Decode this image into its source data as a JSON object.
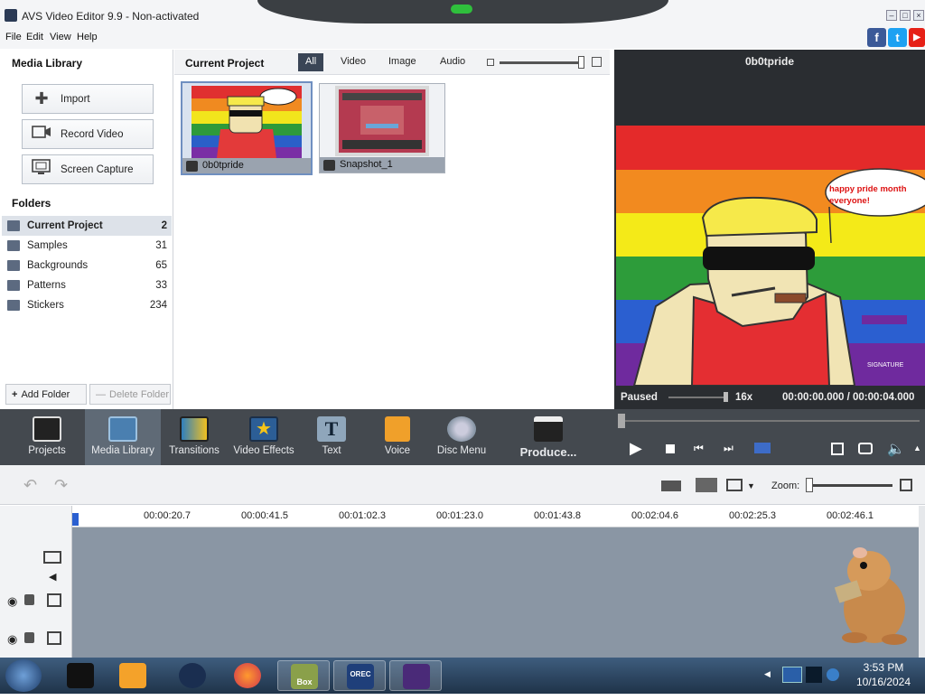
{
  "window": {
    "title": "AVS Video Editor 9.9 - Non-activated"
  },
  "menu": [
    "File",
    "Edit",
    "View",
    "Help"
  ],
  "social": {
    "facebook": "f",
    "twitter": "t",
    "youtube": "▶"
  },
  "media_library": {
    "header": "Media Library",
    "buttons": [
      {
        "label": "Import",
        "icon": "plus-icon"
      },
      {
        "label": "Record Video",
        "icon": "camera-icon"
      },
      {
        "label": "Screen Capture",
        "icon": "monitor-icon"
      }
    ],
    "folders_header": "Folders",
    "folders": [
      {
        "name": "Current Project",
        "count": "2"
      },
      {
        "name": "Samples",
        "count": "31"
      },
      {
        "name": "Backgrounds",
        "count": "65"
      },
      {
        "name": "Patterns",
        "count": "33"
      },
      {
        "name": "Stickers",
        "count": "234"
      }
    ],
    "add_folder": "Add Folder",
    "delete_folder": "Delete Folder"
  },
  "project": {
    "header": "Current Project",
    "tabs": [
      "All",
      "Video",
      "Image",
      "Audio"
    ],
    "items": [
      {
        "name": "0b0tpride"
      },
      {
        "name": "Snapshot_1"
      }
    ]
  },
  "preview": {
    "title": "0b0tpride",
    "speech": "happy pride month everyone!",
    "signature": "SIGNATURE",
    "status": "Paused",
    "speed": "16x",
    "time": "00:00:00.000 / 00:00:04.000"
  },
  "toolbar": [
    {
      "label": "Projects",
      "icon": "clapper-icon"
    },
    {
      "label": "Media Library",
      "icon": "film-icon"
    },
    {
      "label": "Transitions",
      "icon": "transitions-icon"
    },
    {
      "label": "Video Effects",
      "icon": "star-icon"
    },
    {
      "label": "Text",
      "icon": "text-icon"
    },
    {
      "label": "Voice",
      "icon": "microphone-icon"
    },
    {
      "label": "Disc Menu",
      "icon": "disc-icon"
    },
    {
      "label": "Produce...",
      "icon": "produce-icon"
    }
  ],
  "timeline": {
    "zoom_label": "Zoom:",
    "marks": [
      "00:00:20.7",
      "00:00:41.5",
      "00:01:02.3",
      "00:01:23.0",
      "00:01:43.8",
      "00:02:04.6",
      "00:02:25.3",
      "00:02:46.1"
    ]
  },
  "taskbar": {
    "time": "3:53 PM",
    "date": "10/16/2024",
    "box_label": "Box",
    "rec_label": "OREC"
  }
}
